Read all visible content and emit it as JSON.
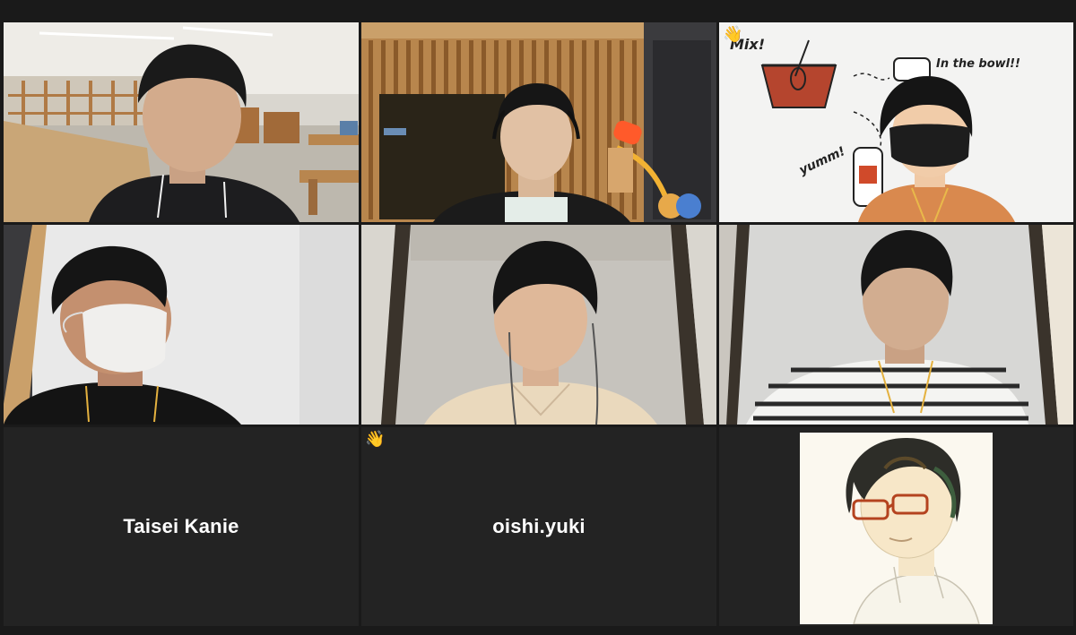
{
  "meeting": {
    "participants": [
      {
        "id": "p1",
        "video": "on",
        "scene": "office"
      },
      {
        "id": "p2",
        "video": "on",
        "scene": "booth"
      },
      {
        "id": "p3",
        "video": "on",
        "scene": "whiteboard",
        "reaction_icon": "wave-hand-icon",
        "whiteboard_texts": [
          "Mix!",
          "In the bowl!!",
          "yumm!"
        ]
      },
      {
        "id": "p4",
        "video": "on",
        "scene": "booth"
      },
      {
        "id": "p5",
        "video": "on",
        "scene": "booth",
        "active_speaker": true
      },
      {
        "id": "p6",
        "video": "on",
        "scene": "booth"
      },
      {
        "id": "p7",
        "video": "off",
        "name": "Taisei Kanie"
      },
      {
        "id": "p8",
        "video": "off",
        "name": "oishi.yuki",
        "reaction_icon": "wave-hand-icon"
      },
      {
        "id": "p9",
        "video": "off",
        "profile_picture": "illustrated-avatar"
      }
    ]
  },
  "colors": {
    "background": "#1a1a1a",
    "tile_background": "#232323",
    "active_speaker_border": "#b8d65a",
    "name_text": "#ffffff"
  }
}
